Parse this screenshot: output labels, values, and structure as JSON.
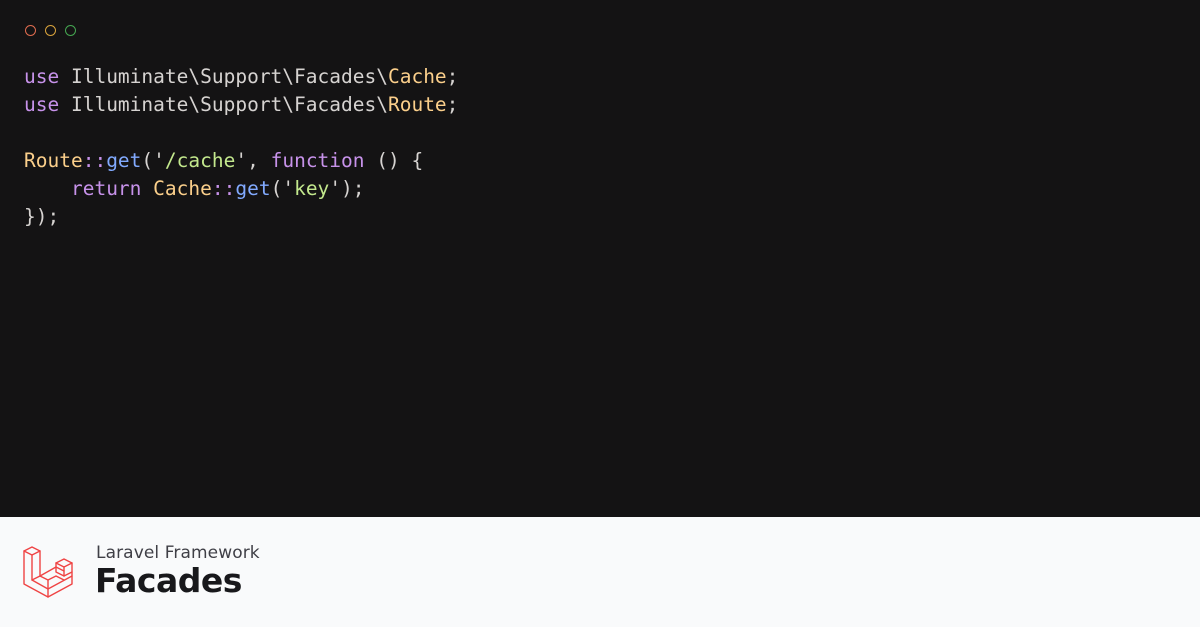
{
  "window": {
    "dots": [
      {
        "name": "close-dot",
        "color": "#e06c4f"
      },
      {
        "name": "minimize-dot",
        "color": "#d9a33c"
      },
      {
        "name": "maximize-dot",
        "color": "#45a651"
      }
    ]
  },
  "colors": {
    "keyword": "#c792ea",
    "text": "#d6d3d1",
    "class": "#fbcf8b",
    "operator": "#c792ea",
    "method": "#82aaff",
    "string": "#c3e88d",
    "punct": "#d6d3d1",
    "brand": "#ef4444"
  },
  "code": {
    "lines": [
      [
        {
          "t": "use",
          "c": "keyword"
        },
        {
          "t": " Illuminate\\Support\\Facades\\",
          "c": "text"
        },
        {
          "t": "Cache",
          "c": "class"
        },
        {
          "t": ";",
          "c": "punct"
        }
      ],
      [
        {
          "t": "use",
          "c": "keyword"
        },
        {
          "t": " Illuminate\\Support\\Facades\\",
          "c": "text"
        },
        {
          "t": "Route",
          "c": "class"
        },
        {
          "t": ";",
          "c": "punct"
        }
      ],
      [],
      [
        {
          "t": "Route",
          "c": "class"
        },
        {
          "t": "::",
          "c": "operator"
        },
        {
          "t": "get",
          "c": "method"
        },
        {
          "t": "('",
          "c": "punct"
        },
        {
          "t": "/cache",
          "c": "string"
        },
        {
          "t": "', ",
          "c": "punct"
        },
        {
          "t": "function",
          "c": "keyword"
        },
        {
          "t": " () {",
          "c": "punct"
        }
      ],
      [
        {
          "t": "    ",
          "c": "text"
        },
        {
          "t": "return",
          "c": "keyword"
        },
        {
          "t": " ",
          "c": "text"
        },
        {
          "t": "Cache",
          "c": "class"
        },
        {
          "t": "::",
          "c": "operator"
        },
        {
          "t": "get",
          "c": "method"
        },
        {
          "t": "('",
          "c": "punct"
        },
        {
          "t": "key",
          "c": "string"
        },
        {
          "t": "');",
          "c": "punct"
        }
      ],
      [
        {
          "t": "});",
          "c": "punct"
        }
      ]
    ]
  },
  "footer": {
    "logo_icon": "laravel-logo-icon",
    "subtitle": "Laravel Framework",
    "title": "Facades"
  }
}
